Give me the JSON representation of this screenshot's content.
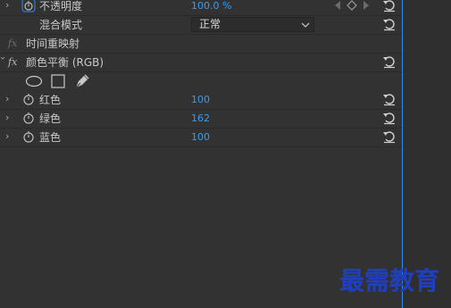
{
  "rows": {
    "opacity": {
      "label": "不透明度",
      "value": "100.0 %"
    },
    "blend_mode": {
      "label": "混合模式",
      "value": "正常"
    },
    "time_remap": {
      "label": "时间重映射",
      "fx": "fx"
    },
    "color_balance": {
      "label": "颜色平衡 (RGB)",
      "fx": "fx"
    },
    "red": {
      "label": "红色",
      "value": "100"
    },
    "green": {
      "label": "绿色",
      "value": "162"
    },
    "blue": {
      "label": "蓝色",
      "value": "100"
    }
  },
  "colors": {
    "value_blue": "#3e9bea",
    "timeline_blue": "#2d8ceb",
    "watermark_blue": "#1f3fbf"
  },
  "watermark": {
    "text": "最需教育"
  }
}
